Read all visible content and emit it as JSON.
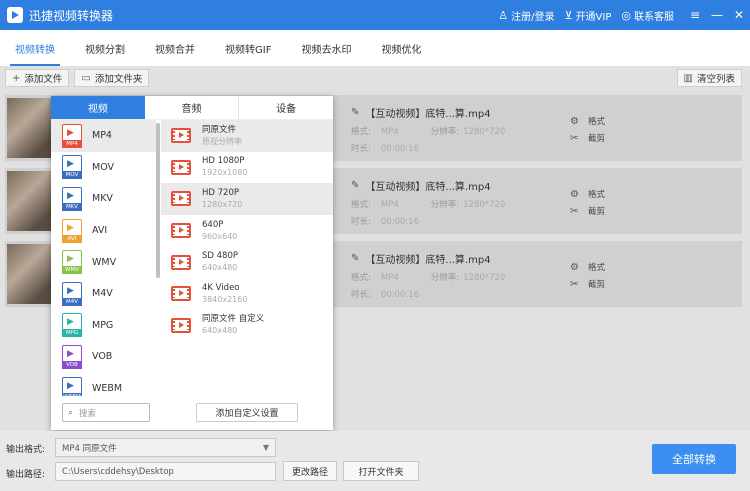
{
  "app": {
    "title": "迅捷视频转换器",
    "register_login": "注册/登录",
    "vip": "开通VIP",
    "service": "联系客服"
  },
  "tabs": [
    "视频转换",
    "视频分割",
    "视频合并",
    "视频转GIF",
    "视频去水印",
    "视频优化"
  ],
  "toolbar": {
    "add_file": "添加文件",
    "add_folder": "添加文件夹",
    "clear_list": "清空列表"
  },
  "files": [
    {
      "name": "【互动视频】底特...算.mp4",
      "format_label": "格式:",
      "format": "MP4",
      "res_label": "分辨率:",
      "resolution": "1280*720",
      "dur_label": "时长:",
      "duration": "00:00:16",
      "format_action": "格式",
      "cut_action": "截剪"
    },
    {
      "name": "【互动视频】底特...算.mp4",
      "format_label": "格式:",
      "format": "MP4",
      "res_label": "分辨率:",
      "resolution": "1280*720",
      "dur_label": "时长:",
      "duration": "00:00:16",
      "format_action": "格式",
      "cut_action": "截剪"
    },
    {
      "name": "【互动视频】底特...算.mp4",
      "format_label": "格式:",
      "format": "MP4",
      "res_label": "分辨率:",
      "resolution": "1280*720",
      "dur_label": "时长:",
      "duration": "00:00:16",
      "format_action": "格式",
      "cut_action": "截剪"
    }
  ],
  "popup": {
    "tabs": [
      "视频",
      "音频",
      "设备"
    ],
    "formats": [
      {
        "name": "MP4",
        "color": "#e3513a"
      },
      {
        "name": "MOV",
        "color": "#3a6ec2"
      },
      {
        "name": "MKV",
        "color": "#3a6ec2"
      },
      {
        "name": "AVI",
        "color": "#f0a030"
      },
      {
        "name": "WMV",
        "color": "#8bc34a"
      },
      {
        "name": "M4V",
        "color": "#3a6ec2"
      },
      {
        "name": "MPG",
        "color": "#26b5a8"
      },
      {
        "name": "VOB",
        "color": "#8a4fc8"
      },
      {
        "name": "WEBM",
        "color": "#3a6ec2"
      }
    ],
    "resolutions": [
      {
        "title": "同原文件",
        "sub": "原视分辨率"
      },
      {
        "title": "HD 1080P",
        "sub": "1920x1080"
      },
      {
        "title": "HD 720P",
        "sub": "1280x720"
      },
      {
        "title": "640P",
        "sub": "960x640"
      },
      {
        "title": "SD 480P",
        "sub": "640x480"
      },
      {
        "title": "4K Video",
        "sub": "3840x2160"
      },
      {
        "title": "同原文件 自定义",
        "sub": "640x480"
      }
    ],
    "search_placeholder": "搜索",
    "add_custom": "添加自定义设置"
  },
  "bottom": {
    "output_format_label": "输出格式:",
    "output_format": "MP4  同原文件",
    "output_path_label": "输出路径:",
    "output_path": "C:\\Users\\cddehsy\\Desktop",
    "change_path": "更改路径",
    "open_folder": "打开文件夹",
    "convert_all": "全部转换"
  },
  "colors": {
    "accent": "#2f7fe0",
    "button": "#3c8ef0",
    "resolution_icon": "#e3513a"
  }
}
